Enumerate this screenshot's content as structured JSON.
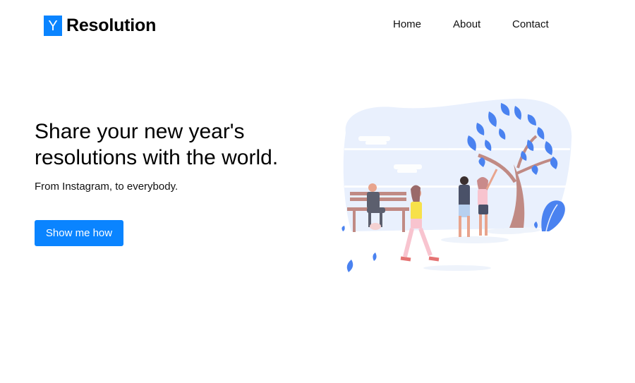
{
  "brand": {
    "logo_letter": "Y",
    "name": "Resolution",
    "accent": "#0a84ff"
  },
  "nav": {
    "home": "Home",
    "about": "About",
    "contact": "Contact"
  },
  "hero": {
    "title": "Share your new year's resolutions with the world.",
    "subtitle": "From Instagram, to everybody.",
    "cta": "Show me how"
  },
  "illustration": {
    "icon": "people-in-park-illustration"
  }
}
